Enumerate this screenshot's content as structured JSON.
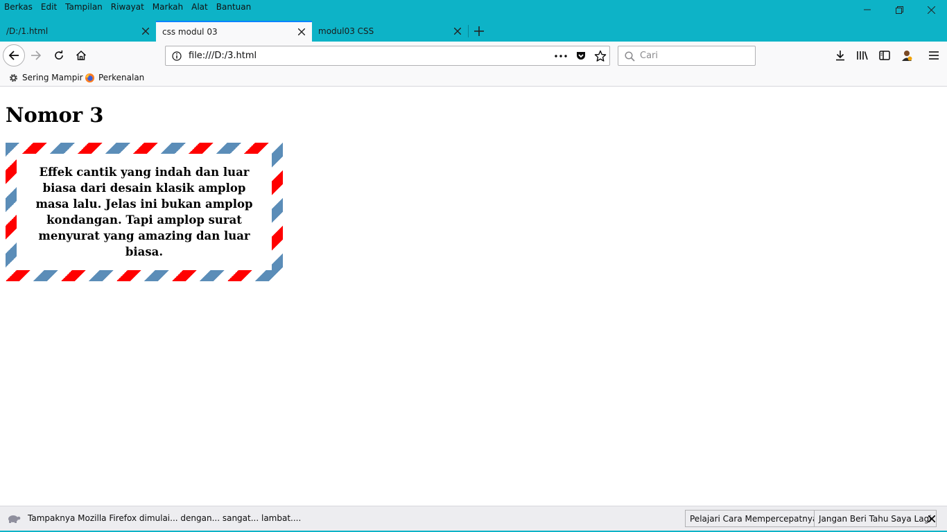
{
  "menu": [
    "Berkas",
    "Edit",
    "Tampilan",
    "Riwayat",
    "Markah",
    "Alat",
    "Bantuan"
  ],
  "tabs": [
    {
      "label": "/D:/1.html"
    },
    {
      "label": "css modul 03"
    },
    {
      "label": "modul03 CSS"
    }
  ],
  "active_tab": "css modul 03",
  "urlbar": {
    "url": "file:///D:/3.html"
  },
  "search": {
    "placeholder": "Cari"
  },
  "bookmarks": [
    "Sering Mampir",
    "Perkenalan"
  ],
  "page": {
    "heading": "Nomor 3",
    "envelope_text": "Effek cantik yang indah dan luar biasa dari desain klasik amplop masa lalu. Jelas ini bukan amplop kondangan. Tapi amplop surat menyurat yang amazing dan luar biasa."
  },
  "notification": {
    "message": "Tampaknya Mozilla Firefox dimulai... dengan... sangat... lambat....",
    "learn_button": "Pelajari Cara Mempercepatnya",
    "dismiss_button": "Jangan Beri Tahu Saya Lagi"
  },
  "colors": {
    "chrome_accent": "#0db3c7",
    "envelope_red": "#ff0000",
    "envelope_blue": "#5b8db8",
    "selected_tab_indicator": "#0a84ff"
  }
}
